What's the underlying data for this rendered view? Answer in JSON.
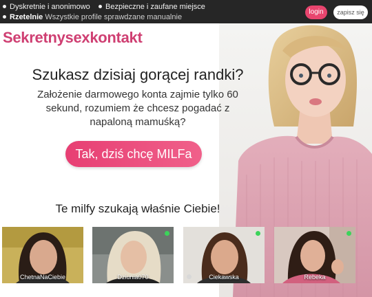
{
  "topbar": {
    "features": [
      {
        "text": "Dyskretnie i anonimowo"
      },
      {
        "text": "Bezpieczne i zaufane miejsce"
      }
    ],
    "trust": {
      "bold": "Rzetelnie",
      "text": "Wszystkie profile sprawdzane manualnie"
    },
    "login_label": "login",
    "register_label": "zapisz się"
  },
  "hero": {
    "logo": "Sekretnysexkontakt",
    "headline": "Szukasz dzisiaj gorącej randki?",
    "subtext": "Założenie darmowego konta zajmie tylko 60 sekund, rozumiem że chcesz pogadać z napaloną mamuśką?",
    "cta_label": "Tak, dziś chcę MILFa"
  },
  "profiles": {
    "title": "Te milfy szukają właśnie Ciebie!",
    "items": [
      {
        "name": "ChetnaNaCiebie",
        "online": false
      },
      {
        "name": "Dziunia070",
        "online": true
      },
      {
        "name": "Ciekawska",
        "online": true
      },
      {
        "name": "Rebeka",
        "online": true
      }
    ]
  },
  "colors": {
    "accent": "#e8456e",
    "logo": "#cf3f72",
    "topbar": "#262626",
    "online": "#3cd35a"
  }
}
